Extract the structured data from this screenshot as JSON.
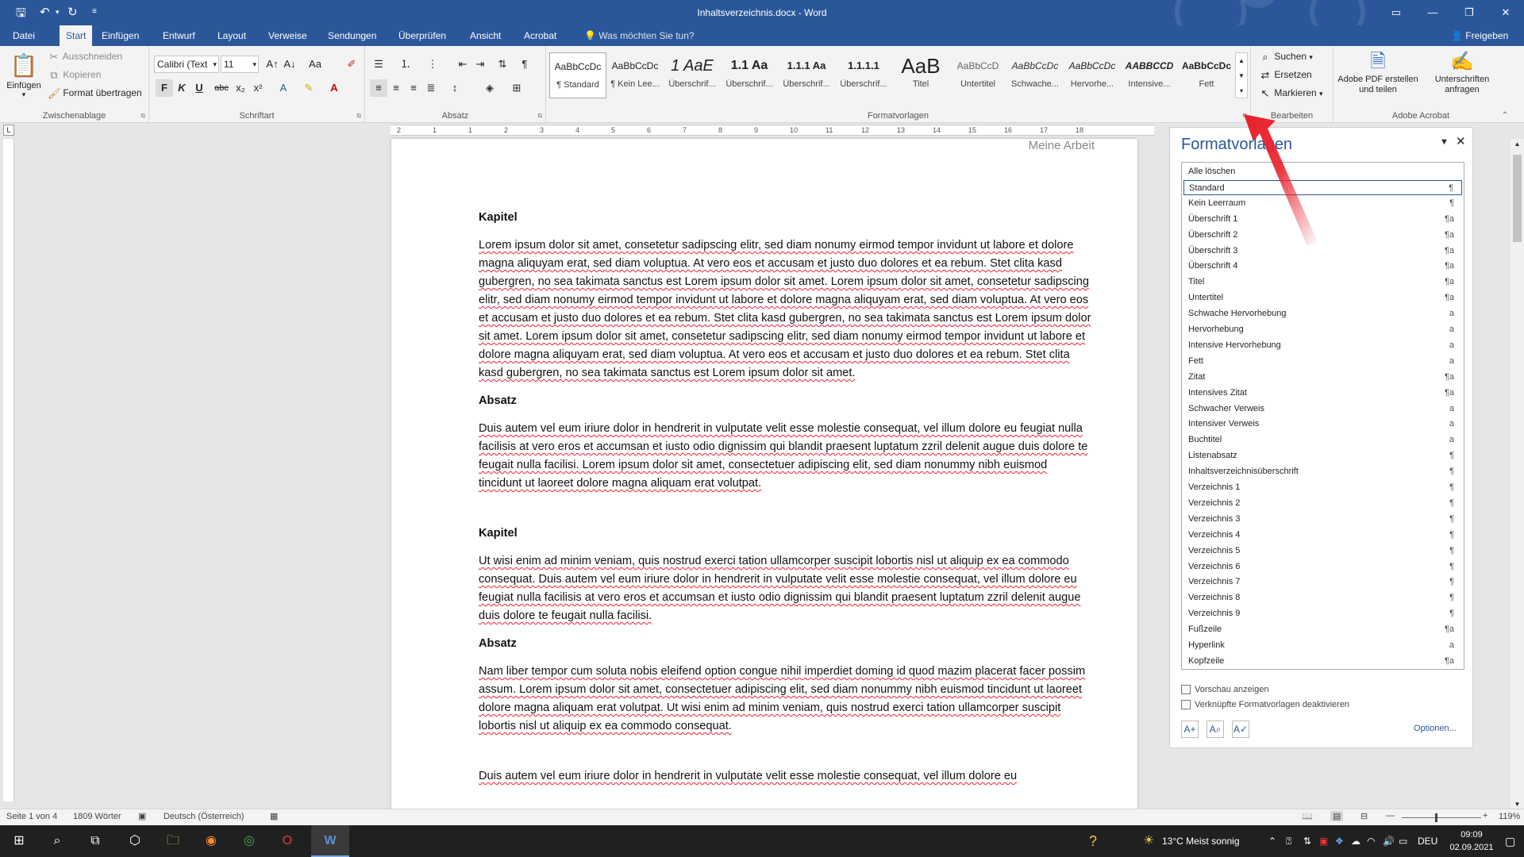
{
  "window": {
    "title": "Inhaltsverzeichnis.docx - Word",
    "qat": [
      "save-icon",
      "undo-icon",
      "redo-icon",
      "customize-icon"
    ]
  },
  "tabs": [
    "Datei",
    "Start",
    "Einfügen",
    "Entwurf",
    "Layout",
    "Verweise",
    "Sendungen",
    "Überprüfen",
    "Ansicht",
    "Acrobat"
  ],
  "active_tab": "Start",
  "tell_me": "Was möchten Sie tun?",
  "share": "Freigeben",
  "ribbon": {
    "clipboard": {
      "paste": "Einfügen",
      "cut": "Ausschneiden",
      "copy": "Kopieren",
      "format_painter": "Format übertragen",
      "label": "Zwischenablage"
    },
    "font": {
      "name": "Calibri (Text",
      "size": "11",
      "label": "Schriftart",
      "bold": "F",
      "italic": "K",
      "underline": "U"
    },
    "paragraph": {
      "label": "Absatz"
    },
    "styles": {
      "label": "Formatvorlagen",
      "items": [
        {
          "preview": "AaBbCcDc",
          "name": "¶ Standard"
        },
        {
          "preview": "AaBbCcDc",
          "name": "¶ Kein Lee..."
        },
        {
          "preview": "1  AaE",
          "name": "Überschrif..."
        },
        {
          "preview": "1.1  Aa",
          "name": "Überschrif..."
        },
        {
          "preview": "1.1.1  Aa",
          "name": "Überschrif..."
        },
        {
          "preview": "1.1.1.1",
          "name": "Überschrif..."
        },
        {
          "preview": "AaB",
          "name": "Titel"
        },
        {
          "preview": "AaBbCcD",
          "name": "Untertitel"
        },
        {
          "preview": "AaBbCcDc",
          "name": "Schwache..."
        },
        {
          "preview": "AaBbCcDc",
          "name": "Hervorhe..."
        },
        {
          "preview": "AABBCCD",
          "name": "Intensive..."
        },
        {
          "preview": "AaBbCcDc",
          "name": "Fett"
        }
      ]
    },
    "editing": {
      "find": "Suchen",
      "replace": "Ersetzen",
      "select": "Markieren",
      "label": "Bearbeiten"
    },
    "acrobat": {
      "create_pdf": "Adobe PDF erstellen und teilen",
      "request_sig": "Unterschriften anfragen",
      "label": "Adobe Acrobat"
    }
  },
  "ruler_numbers": [
    "2",
    "1",
    "1",
    "2",
    "3",
    "4",
    "5",
    "6",
    "7",
    "8",
    "9",
    "10",
    "11",
    "12",
    "13",
    "14",
    "15",
    "16",
    "17",
    "18"
  ],
  "document": {
    "header": "Meine Arbeit",
    "blocks": [
      {
        "type": "heading",
        "text": "Kapitel"
      },
      {
        "type": "para",
        "text": "Lorem ipsum dolor sit amet, consetetur sadipscing elitr, sed diam nonumy eirmod tempor invidunt ut labore et dolore magna aliquyam erat, sed diam voluptua. At vero eos et accusam et justo duo dolores et ea rebum. Stet clita kasd gubergren, no sea takimata sanctus est Lorem ipsum dolor sit amet. Lorem ipsum dolor sit amet, consetetur sadipscing elitr, sed diam nonumy eirmod tempor invidunt ut labore et dolore magna aliquyam erat, sed diam voluptua. At vero eos et accusam et justo duo dolores et ea rebum. Stet clita kasd gubergren, no sea takimata sanctus est Lorem ipsum dolor sit amet. Lorem ipsum dolor sit amet, consetetur sadipscing elitr, sed diam nonumy eirmod tempor invidunt ut labore et dolore magna aliquyam erat, sed diam voluptua. At vero eos et accusam et justo duo dolores et ea rebum. Stet clita kasd gubergren, no sea takimata sanctus est Lorem ipsum dolor sit amet."
      },
      {
        "type": "heading",
        "text": "Absatz"
      },
      {
        "type": "para",
        "text": "Duis autem vel eum iriure dolor in hendrerit in vulputate velit esse molestie consequat, vel illum dolore eu feugiat nulla facilisis at vero eros et accumsan et iusto odio dignissim qui blandit praesent luptatum zzril delenit augue duis dolore te feugait nulla facilisi. Lorem ipsum dolor sit amet, consectetuer adipiscing elit, sed diam nonummy nibh euismod tincidunt ut laoreet dolore magna aliquam erat volutpat."
      },
      {
        "type": "heading",
        "text": "Kapitel"
      },
      {
        "type": "para",
        "text": "Ut wisi enim ad minim veniam, quis nostrud exerci tation ullamcorper suscipit lobortis nisl ut aliquip ex ea commodo consequat. Duis autem vel eum iriure dolor in hendrerit in vulputate velit esse molestie consequat, vel illum dolore eu feugiat nulla facilisis at vero eros et accumsan et iusto odio dignissim qui blandit praesent luptatum zzril delenit augue duis dolore te feugait nulla facilisi."
      },
      {
        "type": "heading",
        "text": "Absatz"
      },
      {
        "type": "para",
        "text": "Nam liber tempor cum soluta nobis eleifend option congue nihil imperdiet doming id quod mazim placerat facer possim assum. Lorem ipsum dolor sit amet, consectetuer adipiscing elit, sed diam nonummy nibh euismod tincidunt ut laoreet dolore magna aliquam erat volutpat. Ut wisi enim ad minim veniam, quis nostrud exerci tation ullamcorper suscipit lobortis nisl ut aliquip ex ea commodo consequat."
      },
      {
        "type": "para",
        "text": "Duis autem vel eum iriure dolor in hendrerit in vulputate velit esse molestie consequat, vel illum dolore eu"
      }
    ]
  },
  "styles_pane": {
    "title": "Formatvorlagen",
    "items": [
      {
        "name": "Alle löschen",
        "mark": ""
      },
      {
        "name": "Standard",
        "mark": "¶"
      },
      {
        "name": "Kein Leerraum",
        "mark": "¶"
      },
      {
        "name": "Überschrift 1",
        "mark": "¶a"
      },
      {
        "name": "Überschrift 2",
        "mark": "¶a"
      },
      {
        "name": "Überschrift 3",
        "mark": "¶a"
      },
      {
        "name": "Überschrift 4",
        "mark": "¶a"
      },
      {
        "name": "Titel",
        "mark": "¶a"
      },
      {
        "name": "Untertitel",
        "mark": "¶a"
      },
      {
        "name": "Schwache Hervorhebung",
        "mark": "a"
      },
      {
        "name": "Hervorhebung",
        "mark": "a"
      },
      {
        "name": "Intensive Hervorhebung",
        "mark": "a"
      },
      {
        "name": "Fett",
        "mark": "a"
      },
      {
        "name": "Zitat",
        "mark": "¶a"
      },
      {
        "name": "Intensives Zitat",
        "mark": "¶a"
      },
      {
        "name": "Schwacher Verweis",
        "mark": "a"
      },
      {
        "name": "Intensiver Verweis",
        "mark": "a"
      },
      {
        "name": "Buchtitel",
        "mark": "a"
      },
      {
        "name": "Listenabsatz",
        "mark": "¶"
      },
      {
        "name": "Inhaltsverzeichnisüberschrift",
        "mark": "¶"
      },
      {
        "name": "Verzeichnis 1",
        "mark": "¶"
      },
      {
        "name": "Verzeichnis 2",
        "mark": "¶"
      },
      {
        "name": "Verzeichnis 3",
        "mark": "¶"
      },
      {
        "name": "Verzeichnis 4",
        "mark": "¶"
      },
      {
        "name": "Verzeichnis 5",
        "mark": "¶"
      },
      {
        "name": "Verzeichnis 6",
        "mark": "¶"
      },
      {
        "name": "Verzeichnis 7",
        "mark": "¶"
      },
      {
        "name": "Verzeichnis 8",
        "mark": "¶"
      },
      {
        "name": "Verzeichnis 9",
        "mark": "¶"
      },
      {
        "name": "Fußzeile",
        "mark": "¶a"
      },
      {
        "name": "Hyperlink",
        "mark": "a"
      },
      {
        "name": "Kopfzeile",
        "mark": "¶a"
      }
    ],
    "selected_index": 1,
    "show_preview": "Vorschau anzeigen",
    "disable_linked": "Verknüpfte Formatvorlagen deaktivieren",
    "options": "Optionen..."
  },
  "statusbar": {
    "page": "Seite 1 von 4",
    "words": "1809 Wörter",
    "language": "Deutsch (Österreich)",
    "zoom": "119%"
  },
  "taskbar": {
    "weather": "13°C  Meist sonnig",
    "lang": "DEU",
    "time": "09:09",
    "date": "02.09.2021"
  },
  "colors": {
    "accent": "#2b579a",
    "arrow": "#e8202a"
  }
}
